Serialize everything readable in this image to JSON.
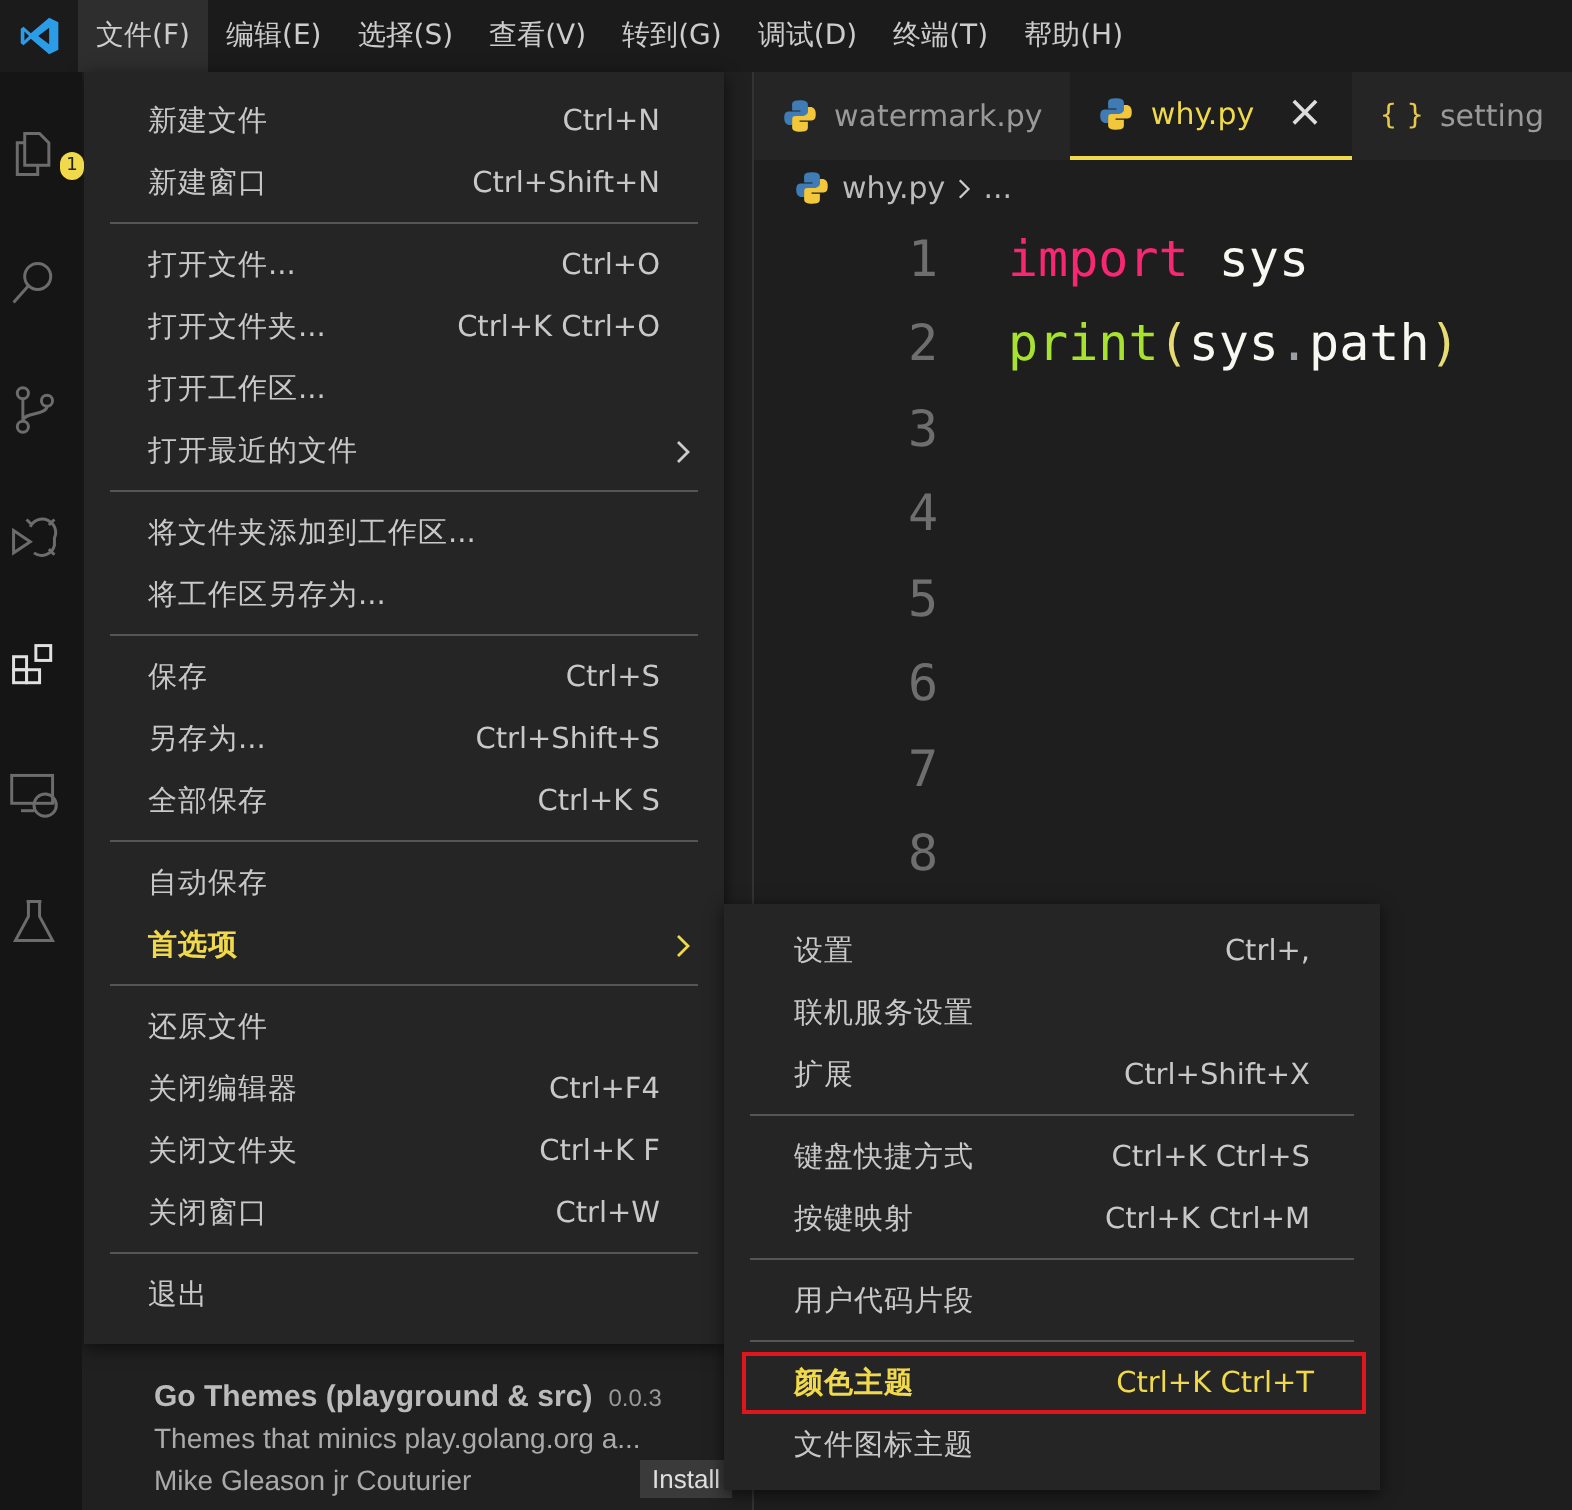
{
  "menubar": [
    {
      "label": "文件(F)",
      "selected": true
    },
    {
      "label": "编辑(E)",
      "selected": false
    },
    {
      "label": "选择(S)",
      "selected": false
    },
    {
      "label": "查看(V)",
      "selected": false
    },
    {
      "label": "转到(G)",
      "selected": false
    },
    {
      "label": "调试(D)",
      "selected": false
    },
    {
      "label": "终端(T)",
      "selected": false
    },
    {
      "label": "帮助(H)",
      "selected": false
    }
  ],
  "activity_bar": [
    {
      "kind": "files",
      "selected": false,
      "badge": "1"
    },
    {
      "kind": "search",
      "selected": false
    },
    {
      "kind": "branch",
      "selected": false
    },
    {
      "kind": "bug",
      "selected": false
    },
    {
      "kind": "extensions",
      "selected": true
    },
    {
      "kind": "remote",
      "selected": false
    },
    {
      "kind": "flask",
      "selected": false
    }
  ],
  "tabs": [
    {
      "label": "watermark.py",
      "kind": "python",
      "selected": false
    },
    {
      "label": "why.py",
      "kind": "python",
      "selected": true,
      "close": "×"
    },
    {
      "label": "setting",
      "kind": "json",
      "glyph": "{ }",
      "selected": false
    }
  ],
  "breadcrumb": {
    "file": "why.py",
    "rest": "..."
  },
  "code": [
    {
      "number": "1",
      "tokens": [
        {
          "kind": "keyword",
          "text": "import"
        },
        {
          "kind": "plain",
          "text": " sys"
        }
      ]
    },
    {
      "number": "2",
      "tokens": [
        {
          "kind": "function",
          "text": "print"
        },
        {
          "kind": "paren",
          "text": "("
        },
        {
          "kind": "plain",
          "text": "sys"
        },
        {
          "kind": "punct",
          "text": "."
        },
        {
          "kind": "plain",
          "text": "path"
        },
        {
          "kind": "paren",
          "text": ")"
        }
      ]
    },
    {
      "number": "3"
    },
    {
      "number": "4"
    },
    {
      "number": "5"
    },
    {
      "number": "6"
    },
    {
      "number": "7"
    },
    {
      "number": "8"
    }
  ],
  "extension": {
    "title": "Go Themes (playground & src)",
    "version": "0.0.3",
    "description": "Themes that minics play.golang.org a...",
    "author": "Mike Gleason jr Couturier",
    "button": "Install"
  },
  "file_menu": [
    [
      {
        "label": "新建文件",
        "shortcut": "Ctrl+N",
        "selected": false,
        "submenu": false
      },
      {
        "label": "新建窗口",
        "shortcut": "Ctrl+Shift+N",
        "selected": false,
        "submenu": false
      }
    ],
    [
      {
        "label": "打开文件...",
        "shortcut": "Ctrl+O",
        "selected": false,
        "submenu": false
      },
      {
        "label": "打开文件夹...",
        "shortcut": "Ctrl+K Ctrl+O",
        "selected": false,
        "submenu": false
      },
      {
        "label": "打开工作区...",
        "selected": false,
        "submenu": false
      },
      {
        "label": "打开最近的文件",
        "selected": false,
        "submenu": true
      }
    ],
    [
      {
        "label": "将文件夹添加到工作区...",
        "selected": false,
        "submenu": false
      },
      {
        "label": "将工作区另存为...",
        "selected": false,
        "submenu": false
      }
    ],
    [
      {
        "label": "保存",
        "shortcut": "Ctrl+S",
        "selected": false,
        "submenu": false
      },
      {
        "label": "另存为...",
        "shortcut": "Ctrl+Shift+S",
        "selected": false,
        "submenu": false
      },
      {
        "label": "全部保存",
        "shortcut": "Ctrl+K S",
        "selected": false,
        "submenu": false
      }
    ],
    [
      {
        "label": "自动保存",
        "selected": false,
        "submenu": false
      },
      {
        "label": "首选项",
        "selected": true,
        "submenu": true
      }
    ],
    [
      {
        "label": "还原文件",
        "selected": false,
        "submenu": false
      },
      {
        "label": "关闭编辑器",
        "shortcut": "Ctrl+F4",
        "selected": false,
        "submenu": false
      },
      {
        "label": "关闭文件夹",
        "shortcut": "Ctrl+K F",
        "selected": false,
        "submenu": false
      },
      {
        "label": "关闭窗口",
        "shortcut": "Ctrl+W",
        "selected": false,
        "submenu": false
      }
    ],
    [
      {
        "label": "退出",
        "selected": false,
        "submenu": false
      }
    ]
  ],
  "preferences_menu": [
    [
      {
        "label": "设置",
        "shortcut": "Ctrl+,",
        "selected": false,
        "outlined": false
      },
      {
        "label": "联机服务设置",
        "selected": false,
        "outlined": false
      },
      {
        "label": "扩展",
        "shortcut": "Ctrl+Shift+X",
        "selected": false,
        "outlined": false
      }
    ],
    [
      {
        "label": "键盘快捷方式",
        "shortcut": "Ctrl+K Ctrl+S",
        "selected": false,
        "outlined": false
      },
      {
        "label": "按键映射",
        "shortcut": "Ctrl+K Ctrl+M",
        "selected": false,
        "outlined": false
      }
    ],
    [
      {
        "label": "用户代码片段",
        "selected": false,
        "outlined": false
      }
    ],
    [
      {
        "label": "颜色主题",
        "shortcut": "Ctrl+K Ctrl+T",
        "selected": true,
        "outlined": true
      },
      {
        "label": "文件图标主题",
        "selected": false,
        "outlined": false
      }
    ]
  ]
}
